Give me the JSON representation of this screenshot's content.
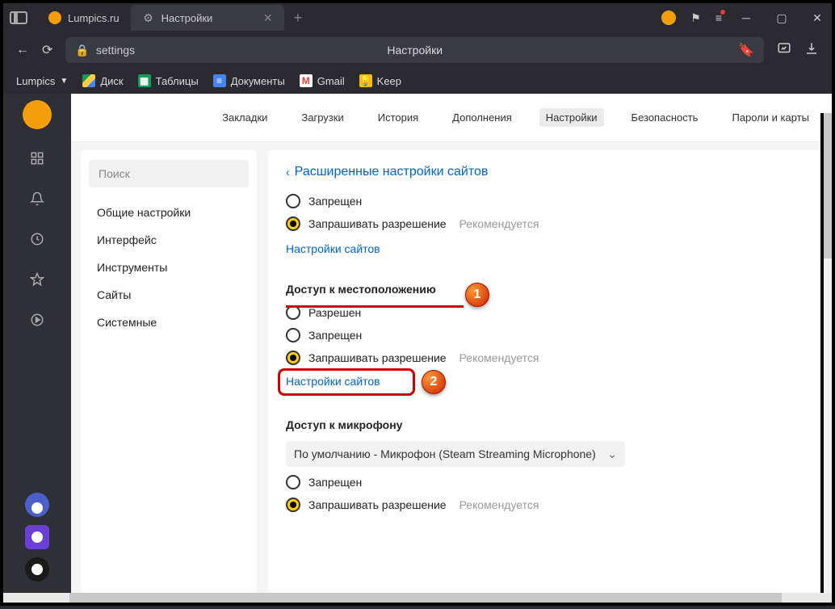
{
  "titlebar": {
    "tab1": {
      "label": "Lumpics.ru"
    },
    "tab2": {
      "label": "Настройки"
    }
  },
  "addressbar": {
    "url": "settings",
    "title": "Настройки"
  },
  "bookmarks": {
    "lumpics": "Lumpics",
    "drive": "Диск",
    "sheets": "Таблицы",
    "docs": "Документы",
    "gmail": "Gmail",
    "keep": "Keep"
  },
  "topnav": {
    "bookmarks": "Закладки",
    "downloads": "Загрузки",
    "history": "История",
    "addons": "Дополнения",
    "settings": "Настройки",
    "security": "Безопасность",
    "passwords": "Пароли и карты"
  },
  "sidebar": {
    "search_placeholder": "Поиск",
    "general": "Общие настройки",
    "interface": "Интерфейс",
    "tools": "Инструменты",
    "sites": "Сайты",
    "system": "Системные"
  },
  "panel": {
    "breadcrumb": "Расширенные настройки сайтов",
    "forbidden": "Запрещен",
    "ask_permission": "Запрашивать разрешение",
    "recommended": "Рекомендуется",
    "site_settings": "Настройки сайтов",
    "location_title": "Доступ к местоположению",
    "allowed": "Разрешен",
    "mic_title": "Доступ к микрофону",
    "mic_default": "По умолчанию - Микрофон (Steam Streaming Microphone)"
  }
}
